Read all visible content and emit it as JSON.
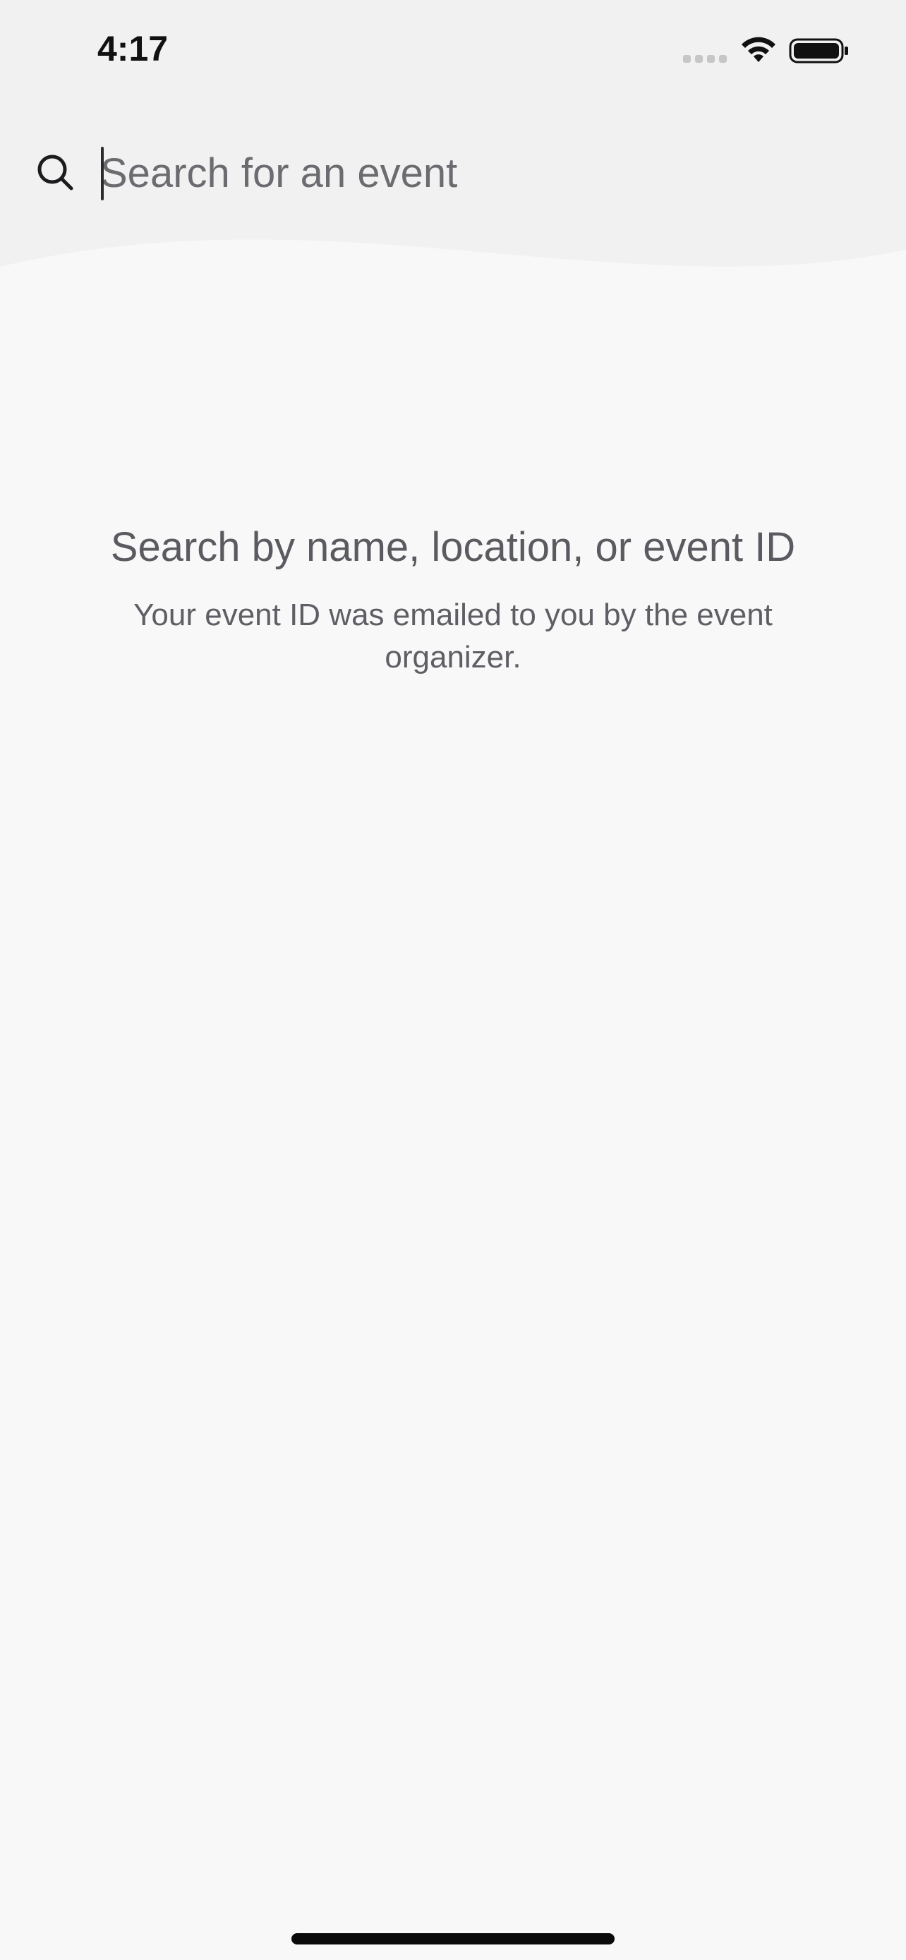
{
  "status_bar": {
    "time": "4:17",
    "icons": [
      "cellular-signal-icon",
      "wifi-icon",
      "battery-icon"
    ]
  },
  "search": {
    "placeholder": "Search for an event",
    "value": "",
    "icon": "search-icon"
  },
  "empty_state": {
    "title": "Search by name, location, or event ID",
    "subtitle": "Your event ID was emailed to you by the event organizer."
  },
  "colors": {
    "background": "#f8f8f8",
    "header_background": "#f1f1f1",
    "primary_text": "#5a5a60",
    "placeholder_text": "#6b6b70",
    "icon": "#1c1c1e"
  }
}
